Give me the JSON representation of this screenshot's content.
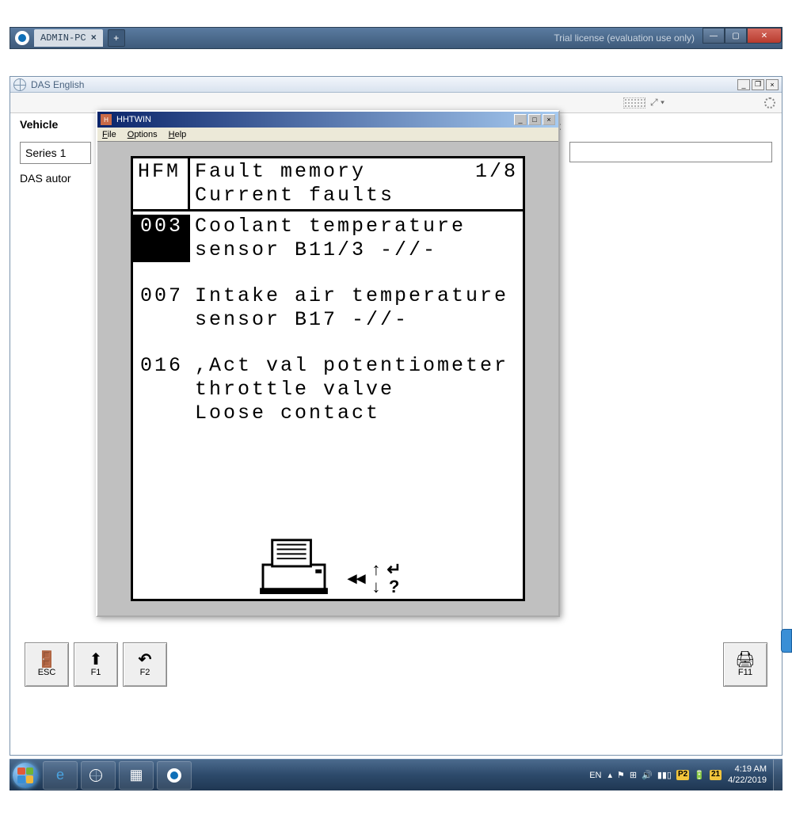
{
  "browser": {
    "tab_label": "ADMIN-PC",
    "trial_text": "Trial license (evaluation use only)"
  },
  "parent": {
    "title": "DAS English",
    "vehicle_label": "Vehicle",
    "series_label": "Series 1",
    "right_letter": "t",
    "das_autor": "DAS autor"
  },
  "hhtwin": {
    "title": "HHTWIN",
    "menu": {
      "file": "File",
      "options": "Options",
      "help": "Help"
    }
  },
  "lcd": {
    "header_left": "HFM",
    "header_title": "Fault memory",
    "page": "1/8",
    "header_sub": "Current faults",
    "faults": [
      {
        "code": "003",
        "selected": true,
        "lines": [
          "Coolant temperature",
          "sensor B11/3 -//-"
        ]
      },
      {
        "code": "007",
        "selected": false,
        "lines": [
          "Intake air temperature",
          "sensor B17 -//-"
        ]
      },
      {
        "code": "016",
        "selected": false,
        "lines": [
          ",Act val potentiometer",
          "throttle valve",
          "Loose contact"
        ]
      }
    ]
  },
  "fkeys": {
    "esc": "ESC",
    "f1": "F1",
    "f2": "F2",
    "f11": "F11"
  },
  "taskbar": {
    "lang": "EN",
    "badge1": "P2",
    "badge2": "21",
    "time": "4:19 AM",
    "date": "4/22/2019"
  }
}
